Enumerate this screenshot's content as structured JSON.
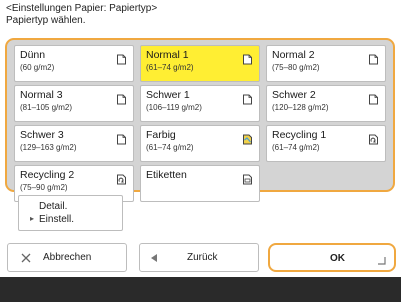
{
  "header": {
    "line1": "<Einstellungen Papier: Papiertyp>",
    "line2": "Papiertyp wählen."
  },
  "paper_types": [
    {
      "name": "Dünn",
      "weight": "(60 g/m2)",
      "icon": "paper-icon",
      "selected": false
    },
    {
      "name": "Normal 1",
      "weight": "(61–74 g/m2)",
      "icon": "paper-icon",
      "selected": true
    },
    {
      "name": "Normal 2",
      "weight": "(75–80 g/m2)",
      "icon": "paper-icon",
      "selected": false
    },
    {
      "name": "Normal 3",
      "weight": "(81–105 g/m2)",
      "icon": "paper-icon",
      "selected": false
    },
    {
      "name": "Schwer 1",
      "weight": "(106–119 g/m2)",
      "icon": "paper-icon",
      "selected": false
    },
    {
      "name": "Schwer 2",
      "weight": "(120–128 g/m2)",
      "icon": "paper-icon",
      "selected": false
    },
    {
      "name": "Schwer 3",
      "weight": "(129–163 g/m2)",
      "icon": "paper-icon",
      "selected": false
    },
    {
      "name": "Farbig",
      "weight": "(61–74 g/m2)",
      "icon": "colored-paper-icon",
      "selected": false
    },
    {
      "name": "Recycling 1",
      "weight": "(61–74 g/m2)",
      "icon": "recycled-paper-icon",
      "selected": false
    },
    {
      "name": "Recycling 2",
      "weight": "(75–90 g/m2)",
      "icon": "recycled-paper-icon",
      "selected": false
    },
    {
      "name": "Etiketten",
      "weight": "",
      "icon": "label-paper-icon",
      "selected": false
    }
  ],
  "detail_button": {
    "line1": "Detail.",
    "line2": "Einstell."
  },
  "buttons": {
    "cancel": {
      "label": "Abbrechen",
      "icon": "close-icon"
    },
    "back": {
      "label": "Zurück",
      "icon": "back-arrow-icon"
    },
    "ok": {
      "label": "OK",
      "icon": "enter-corner-icon"
    }
  },
  "colors": {
    "accent": "#f0a840",
    "selected": "#ffee33",
    "panel": "#d4d4d4",
    "footer": "#2a2a2a"
  }
}
